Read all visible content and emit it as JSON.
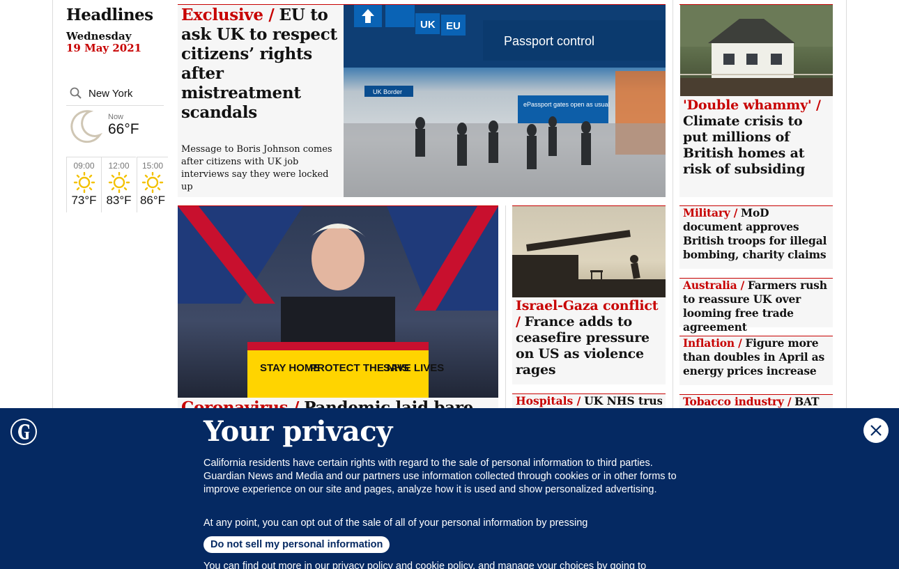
{
  "sidebar": {
    "section_title": "Headlines",
    "weekday": "Wednesday",
    "date": "19 May 2021"
  },
  "weather": {
    "location": "New York",
    "now_label": "Now",
    "now_temp": "66°F",
    "forecast": [
      {
        "time": "09:00",
        "temp": "73°F"
      },
      {
        "time": "12:00",
        "temp": "83°F"
      },
      {
        "time": "15:00",
        "temp": "86°F"
      }
    ]
  },
  "stories": {
    "lead": {
      "kicker": "Exclusive /",
      "headline": "EU to ask UK to respect citizens’ rights after mistreatment scandals",
      "standfirst": "Message to Boris Johnson comes after citizens with UK job interviews say they were locked up"
    },
    "lead_image": {
      "signs": [
        "UK",
        "EU"
      ],
      "passport_sign": "Passport control",
      "border_sign": "UK Border",
      "epassport_sign": "ePassport gates open as usual"
    },
    "subsiding": {
      "kicker": "'Double whammy' /",
      "headline": "Climate crisis to put millions of British homes at risk of subsiding"
    },
    "covid_image": {
      "lectern_words": [
        "STAY HOME",
        "PROTECT THE NHS",
        "SAVE LIVES"
      ]
    },
    "coronavirus": {
      "kicker": "Coronavirus /",
      "headline": "Pandemic laid bare"
    },
    "israel": {
      "kicker": "Israel-Gaza conflict /",
      "headline": "France adds to ceasefire pressure on US as violence rages"
    },
    "military": {
      "kicker": "Military /",
      "headline": "MoD document approves British troops for illegal bombing, charity claims"
    },
    "australia": {
      "kicker": "Australia /",
      "headline": "Farmers rush to reassure UK over looming free trade agreement"
    },
    "inflation": {
      "kicker": "Inflation /",
      "headline": "Figure more than doubles in April as energy prices increase"
    },
    "hospitals": {
      "kicker": "Hospitals /",
      "headline": "UK NHS trusts"
    },
    "tobacco": {
      "kicker": "Tobacco industry /",
      "headline": "BAT"
    }
  },
  "privacy": {
    "title": "Your privacy",
    "body": "California residents have certain rights with regard to the sale of personal information to third parties. Guardian News and Media and our partners use information collected through cookies or in other forms to improve experience on our site and pages, analyze how it is used and show personalized advertising.",
    "optout_text": "At any point, you can opt out of the sale of all of your personal information by pressing",
    "button_label": "Do not sell my personal information",
    "more_text": "You can find out more in our privacy policy and cookie policy, and manage your choices by going to"
  },
  "colors": {
    "accent": "#c70000",
    "privacy_bg": "#052962",
    "card_bg": "#f6f6f6"
  }
}
